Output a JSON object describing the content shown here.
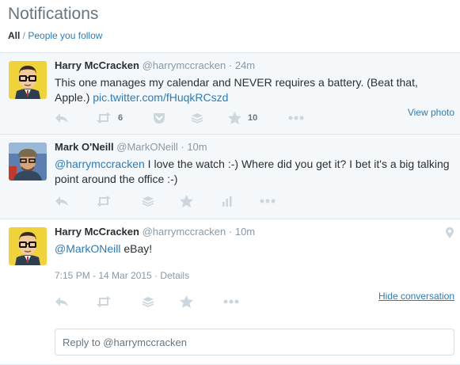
{
  "header": {
    "title": "Notifications",
    "filter_all": "All",
    "separator": " / ",
    "filter_follow": "People you follow"
  },
  "tweets": [
    {
      "fullname": "Harry McCracken",
      "username": "@harrymccracken",
      "dot": "·",
      "time": "24m",
      "text": "This one manages my calendar and NEVER requires a battery. (Beat that, Apple.) ",
      "link": "pic.twitter.com/fHuqkRCszd",
      "retweets": "6",
      "favorites": "10",
      "view_photo": "View photo"
    },
    {
      "fullname": "Mark O'Neill",
      "username": "@MarkONeill",
      "dot": "·",
      "time": "10m",
      "mention": "@harrymccracken",
      "text": " I love the watch :-) Where did you get it? I bet it's a big talking point around the office :-)"
    },
    {
      "fullname": "Harry McCracken",
      "username": "@harrymccracken",
      "dot": "·",
      "time": "10m",
      "mention": "@MarkONeill",
      "text": " eBay!",
      "timestamp": "7:15 PM - 14 Mar 2015",
      "details": "Details",
      "hide_conversation": "Hide conversation"
    }
  ],
  "reply": {
    "placeholder": "Reply to @harrymccracken"
  },
  "icons": {
    "reply": "reply-icon",
    "retweet": "retweet-icon",
    "pocket": "pocket-icon",
    "buffer": "buffer-icon",
    "favorite": "star-icon",
    "analytics": "analytics-icon",
    "more": "more-icon",
    "location": "location-pin-icon"
  },
  "colors": {
    "link": "#2b7bb9",
    "icon": "#ccd6dd",
    "muted": "#8899a6",
    "text": "#292f33",
    "alt_bg": "#f5f8fa"
  }
}
